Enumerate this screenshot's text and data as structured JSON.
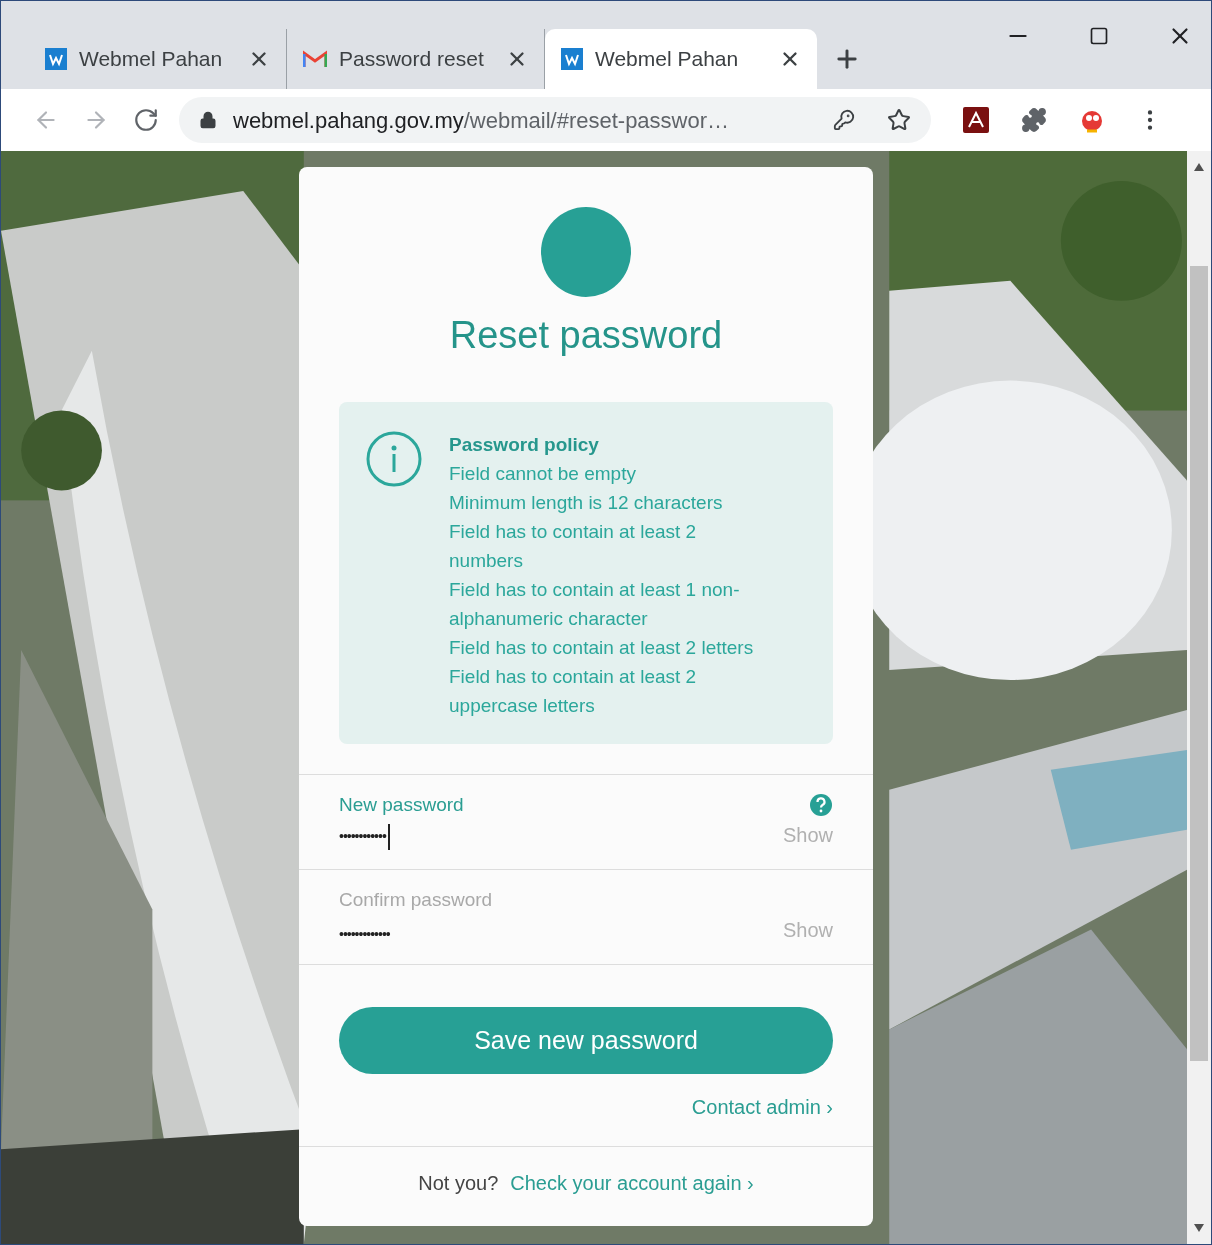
{
  "tabs": [
    {
      "kind": "webmel",
      "title": "Webmel Pahan",
      "selected": false
    },
    {
      "kind": "gmail",
      "title": "Password reset",
      "selected": false
    },
    {
      "kind": "webmel",
      "title": "Webmel Pahan",
      "selected": true
    }
  ],
  "nav": [
    {
      "kind": "back",
      "disabled": true
    },
    {
      "kind": "forward",
      "disabled": true
    },
    {
      "kind": "reload",
      "disabled": false
    }
  ],
  "address": {
    "host": "webmel.pahang.gov.my",
    "path": "/webmail/#reset-passwor…"
  },
  "extensions": [
    {
      "kind": "pdf"
    },
    {
      "kind": "puzzle"
    },
    {
      "kind": "ball"
    }
  ],
  "card": {
    "title": "Reset password",
    "policy": {
      "title": "Password policy",
      "lines": [
        "Field cannot be empty",
        "Minimum length is 12 characters",
        "Field has to contain at least 2 numbers",
        "Field has to contain at least 1 non-alphanumeric character",
        "Field has to contain at least 2 letters",
        "Field has to contain at least 2 uppercase letters"
      ]
    },
    "fields": [
      {
        "label": "New password",
        "value": "••••••••••••",
        "focused": true,
        "help": true,
        "toggle": "Show"
      },
      {
        "label": "Confirm password",
        "value": "•••••••••••••",
        "focused": false,
        "help": false,
        "toggle": "Show"
      }
    ],
    "submit": "Save new password",
    "contact": "Contact admin ›",
    "footer": {
      "prompt": "Not you?",
      "link": "Check your account again ›"
    }
  }
}
